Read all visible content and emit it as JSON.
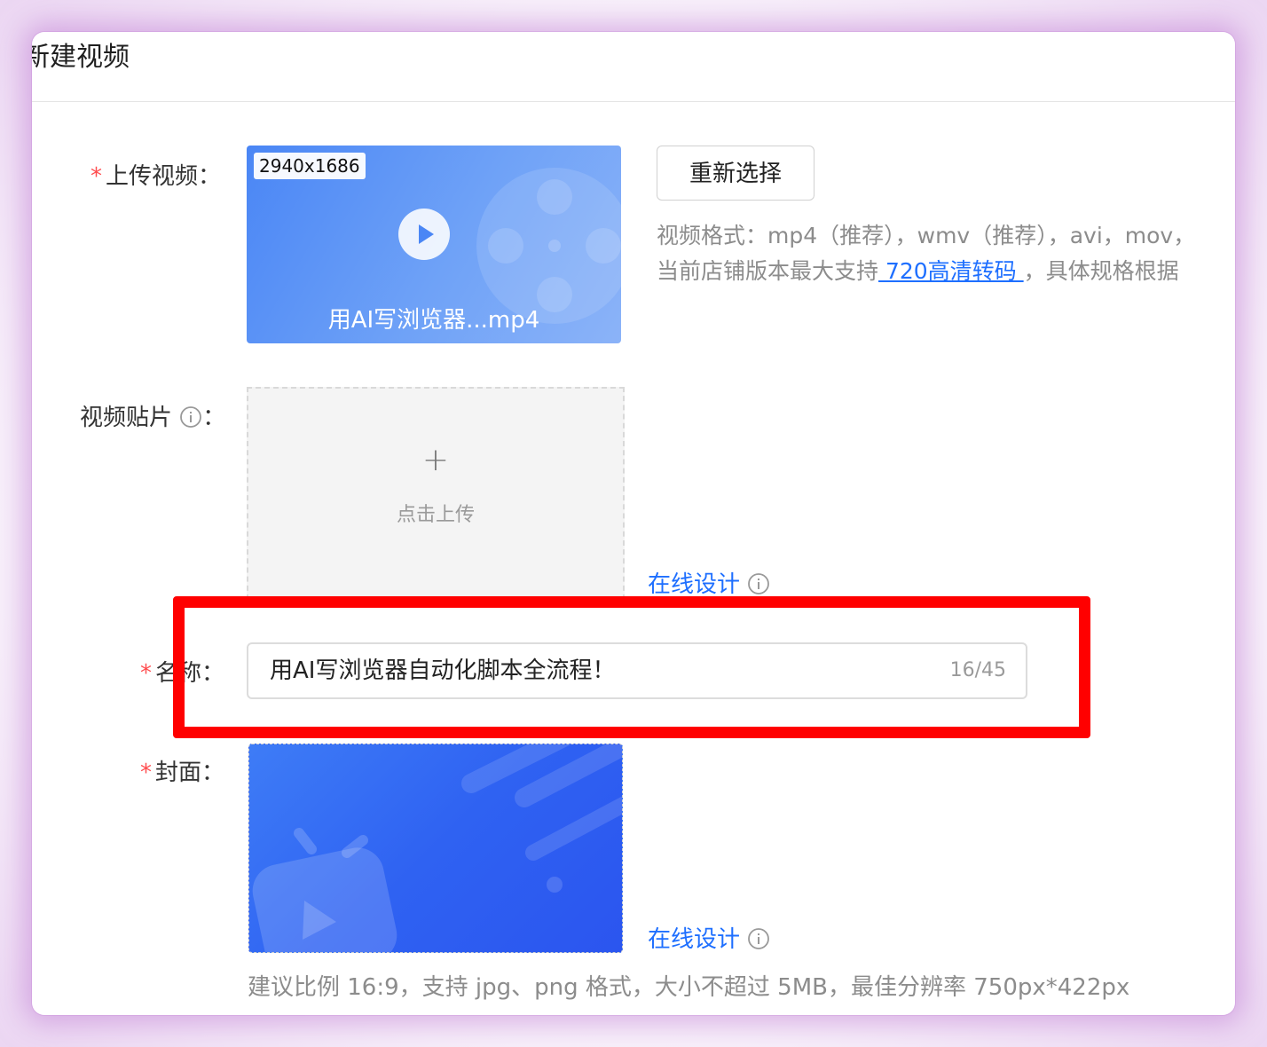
{
  "dialog": {
    "title": "新建视频"
  },
  "upload_video": {
    "label": "上传视频：",
    "dimensions": "2940x1686",
    "filename": "用AI写浏览器...mp4",
    "reselect_button": "重新选择",
    "format_hint": "视频格式：mp4（推荐），wmv（推荐），avi，mov，",
    "version_hint_prefix": "当前店铺版本最大支持",
    "version_hint_link": " 720高清转码 ",
    "version_hint_suffix": "，具体规格根据"
  },
  "video_sticker": {
    "label": "视频贴片",
    "colon": "：",
    "upload_plus": "+",
    "upload_text": "点击上传",
    "design_link": "在线设计"
  },
  "name_field": {
    "label": "名称：",
    "value": "用AI写浏览器自动化脚本全流程！",
    "counter": "16/45"
  },
  "cover": {
    "label": "封面：",
    "design_link": "在线设计",
    "hint": "建议比例 16:9，支持 jpg、png 格式，大小不超过 5MB，最佳分辨率 750px*422px"
  },
  "colors": {
    "primary": "#1e6fff",
    "required": "#ff4d4f",
    "highlight": "#ff0000"
  },
  "icons": {
    "play": "play-icon",
    "info": "info-icon",
    "film_reel": "film-reel-icon",
    "tv": "tv-icon"
  }
}
